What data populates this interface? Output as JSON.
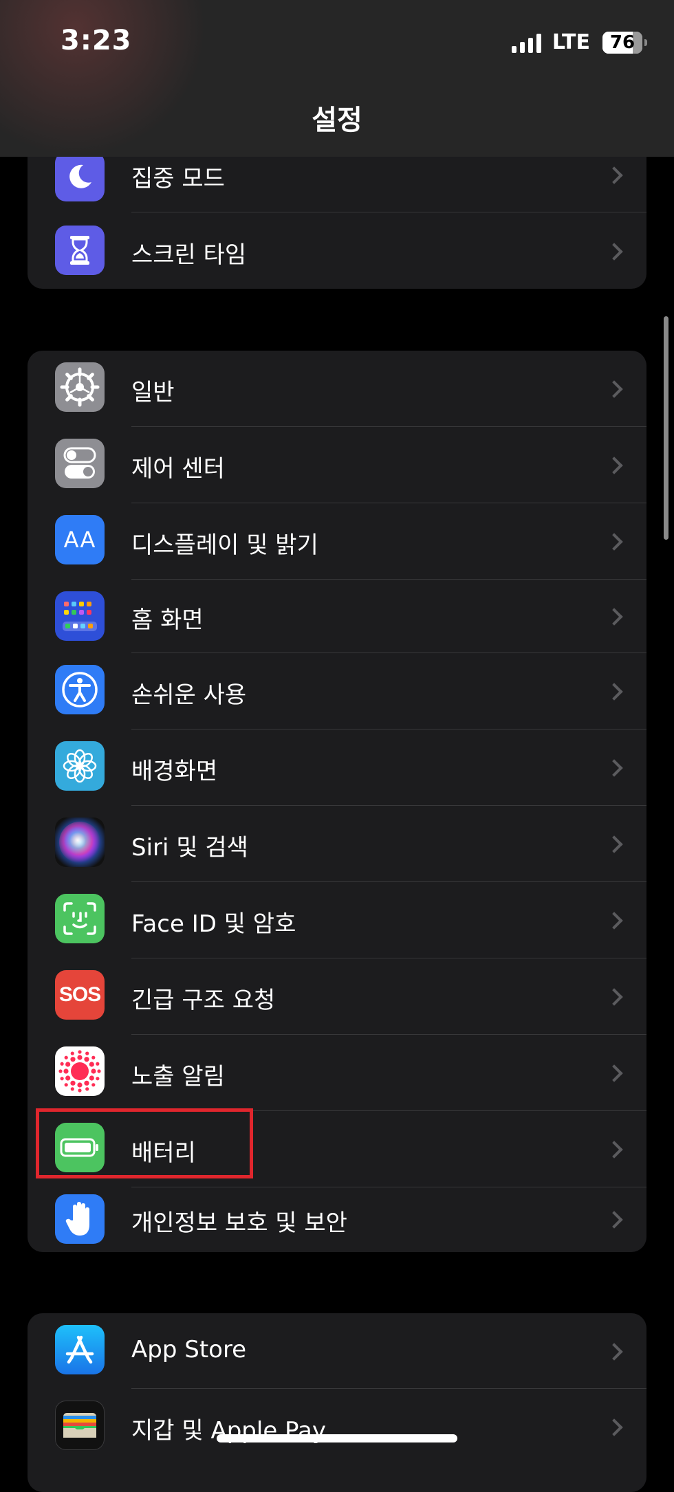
{
  "status_bar": {
    "time": "3:23",
    "network": "LTE",
    "battery_level": "76"
  },
  "nav": {
    "title": "설정"
  },
  "groups": [
    {
      "items": [
        {
          "label": "집중 모드"
        },
        {
          "label": "스크린 타임"
        }
      ]
    },
    {
      "items": [
        {
          "label": "일반"
        },
        {
          "label": "제어 센터"
        },
        {
          "label": "디스플레이 및 밝기",
          "icon_text": "AA"
        },
        {
          "label": "홈 화면"
        },
        {
          "label": "손쉬운 사용"
        },
        {
          "label": "배경화면"
        },
        {
          "label": "Siri 및 검색"
        },
        {
          "label": "Face ID 및 암호"
        },
        {
          "label": "긴급 구조 요청",
          "icon_text": "SOS"
        },
        {
          "label": "노출 알림"
        },
        {
          "label": "배터리"
        },
        {
          "label": "개인정보 보호 및 보안"
        }
      ]
    },
    {
      "items": [
        {
          "label": "App Store"
        },
        {
          "label": "지갑 및 Apple Pay"
        }
      ]
    }
  ],
  "icons": {
    "focus": "moon-icon",
    "screen_time": "hourglass-icon",
    "general": "gear-icon",
    "control_center": "toggles-icon",
    "display": "text-size-icon",
    "home_screen": "app-grid-icon",
    "accessibility": "accessibility-icon",
    "wallpaper": "flower-icon",
    "siri": "siri-icon",
    "face_id": "face-id-icon",
    "sos": "sos-icon",
    "exposure": "exposure-dots-icon",
    "battery": "battery-icon",
    "privacy": "hand-icon",
    "app_store": "app-store-icon",
    "wallet": "wallet-icon"
  },
  "colors": {
    "background": "#000000",
    "cell": "#1c1c1e",
    "highlight": "#e0262d"
  }
}
